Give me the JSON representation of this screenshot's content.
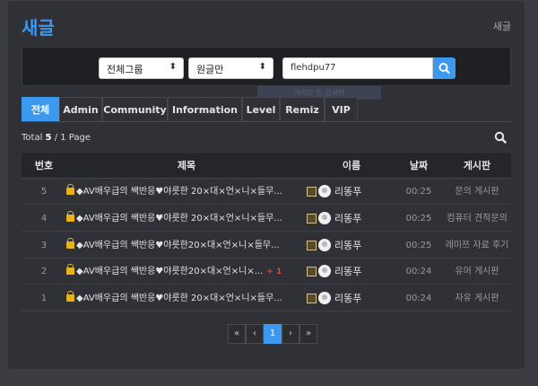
{
  "page": {
    "title": "새글",
    "breadcrumb": "새글"
  },
  "search": {
    "group_select": "전체그룹",
    "scope_select": "원글만",
    "keyword": "flehdpu77",
    "tooltip": "사이트 인 검색어"
  },
  "tabs": [
    "전체",
    "Admin",
    "Community",
    "Information",
    "Level",
    "Remiz",
    "VIP"
  ],
  "total": {
    "prefix": "Total",
    "count": "5",
    "pages": "/ 1 Page"
  },
  "columns": {
    "num": "번호",
    "subject": "제목",
    "name": "이름",
    "date": "날짜",
    "board": "게시판"
  },
  "rows": [
    {
      "num": "5",
      "subject": "◆AV배우급의 쌕반응♥야릇한 20×대×언×니×들무...",
      "comments": "",
      "author": "리똥푸",
      "date": "00:25",
      "board": "문의 게시판"
    },
    {
      "num": "4",
      "subject": "◆AV배우급의 쌕반응♥야릇한 20×대×언×니×들무...",
      "comments": "",
      "author": "리똥푸",
      "date": "00:25",
      "board": "컴퓨터 견적문의"
    },
    {
      "num": "3",
      "subject": "◆AV배우급의 쌕반응♥야릇한20×대×언×니×들무...",
      "comments": "",
      "author": "리똥푸",
      "date": "00:25",
      "board": "레미쯔 자료 후기"
    },
    {
      "num": "2",
      "subject": "◆AV배우급의 쌕반응♥야릇한20×대×언×니×...",
      "comments": "+ 1",
      "author": "리똥푸",
      "date": "00:24",
      "board": "유머 게시판"
    },
    {
      "num": "1",
      "subject": "◆AV배우급의 쌕반응♥야릇한 20×대×언×니×들무...",
      "comments": "",
      "author": "리똥푸",
      "date": "00:24",
      "board": "자유 게시판"
    }
  ],
  "pagination": {
    "first": "«",
    "prev": "‹",
    "current": "1",
    "next": "›",
    "last": "»"
  },
  "colors": {
    "accent": "#3d98f0",
    "background": "#2f3136",
    "comment": "#e0443a"
  },
  "icons": {
    "search": "search-icon",
    "lock": "lock-icon",
    "avatar": "avatar"
  }
}
